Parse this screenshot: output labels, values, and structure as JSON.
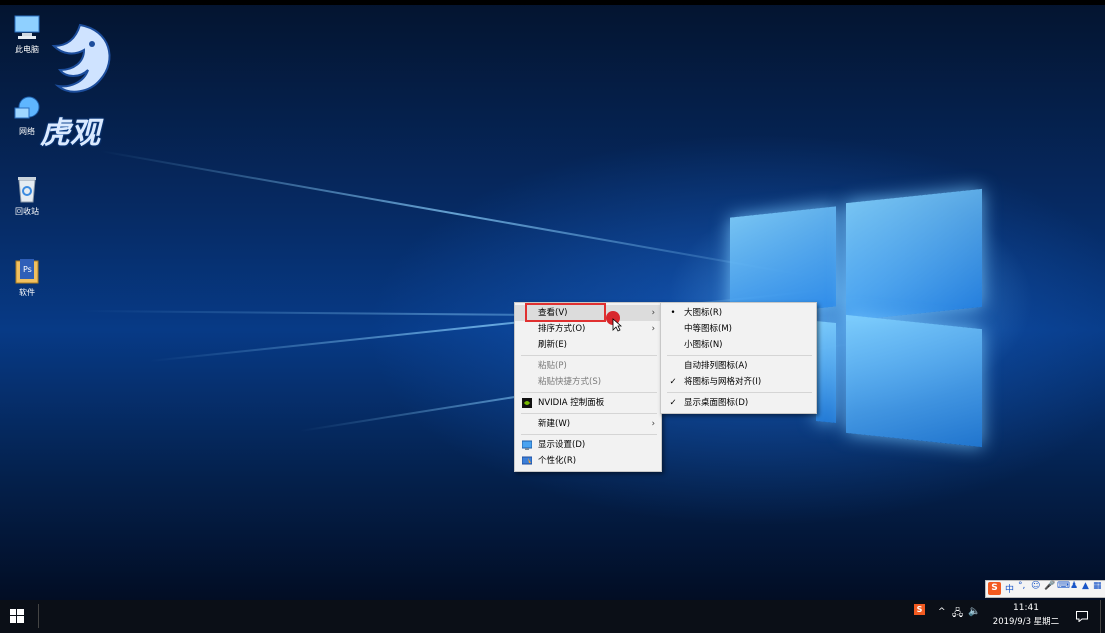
{
  "desktop": {
    "icons": [
      {
        "label": "此电脑",
        "icon": "computer-icon"
      },
      {
        "label": "网络",
        "icon": "network-icon"
      },
      {
        "label": "回收站",
        "icon": "recycle-bin-icon"
      },
      {
        "label": "软件",
        "icon": "folder-icon"
      }
    ],
    "watermark": "虎观"
  },
  "context_menu": {
    "items": [
      {
        "label": "查看(V)",
        "submenu": true
      },
      {
        "label": "排序方式(O)",
        "submenu": true
      },
      {
        "label": "刷新(E)"
      },
      {
        "label": "粘贴(P)",
        "disabled": true
      },
      {
        "label": "粘贴快捷方式(S)",
        "disabled": true
      },
      {
        "label": "NVIDIA 控制面板",
        "icon": "nvidia-icon"
      },
      {
        "label": "新建(W)",
        "submenu": true
      },
      {
        "label": "显示设置(D)",
        "icon": "display-icon"
      },
      {
        "label": "个性化(R)",
        "icon": "personalize-icon"
      }
    ]
  },
  "view_submenu": {
    "items": [
      {
        "label": "大图标(R)",
        "mark": "•"
      },
      {
        "label": "中等图标(M)",
        "mark": ""
      },
      {
        "label": "小图标(N)",
        "mark": ""
      },
      {
        "label": "自动排列图标(A)",
        "mark": ""
      },
      {
        "label": "将图标与网格对齐(I)",
        "mark": "✓"
      },
      {
        "label": "显示桌面图标(D)",
        "mark": "✓"
      }
    ]
  },
  "ime_toolbar": {
    "mode": "中",
    "badge": "S"
  },
  "taskbar": {
    "time": "11:41",
    "date": "2019/9/3 星期二",
    "tray_badge": "S"
  },
  "colors": {
    "highlight_box": "#e03030",
    "cursor_dot": "#d8262c"
  }
}
